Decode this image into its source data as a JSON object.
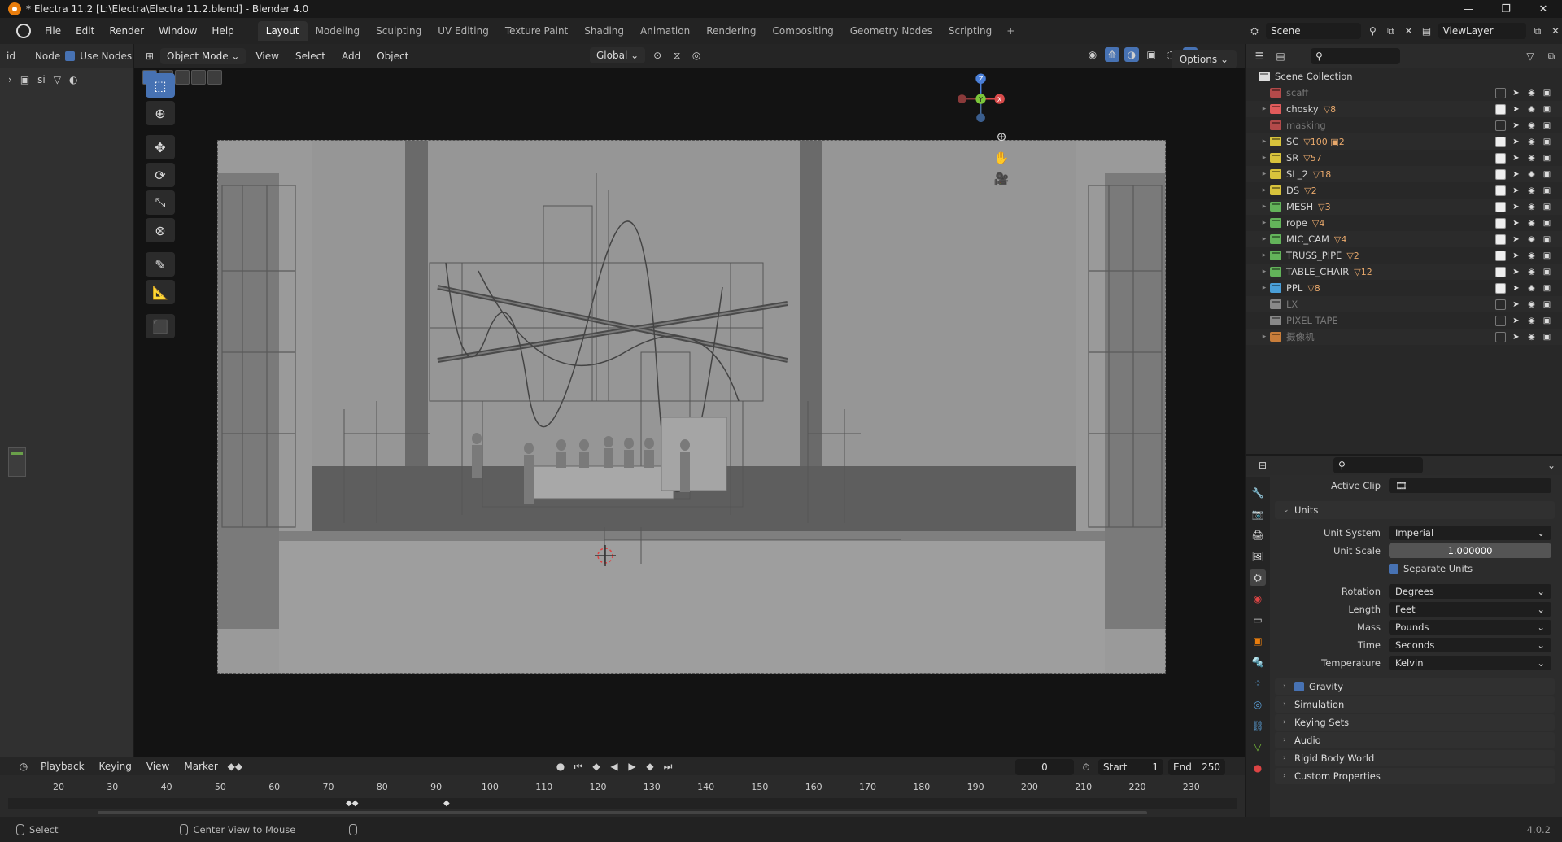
{
  "window": {
    "title": "* Electra 11.2 [L:\\Electra\\Electra 11.2.blend] - Blender 4.0"
  },
  "menu": [
    "File",
    "Edit",
    "Render",
    "Window",
    "Help"
  ],
  "workspaces": [
    "Layout",
    "Modeling",
    "Sculpting",
    "UV Editing",
    "Texture Paint",
    "Shading",
    "Animation",
    "Rendering",
    "Compositing",
    "Geometry Nodes",
    "Scripting"
  ],
  "active_workspace": "Layout",
  "scene": {
    "name": "Scene",
    "view_layer": "ViewLayer"
  },
  "left_panel": {
    "header_items": [
      "id",
      "Node"
    ],
    "use_nodes_label": "Use Nodes",
    "sub_label": "si"
  },
  "viewport": {
    "mode": "Object Mode",
    "menu": [
      "View",
      "Select",
      "Add",
      "Object"
    ],
    "orientation": "Global",
    "options_label": "Options",
    "gizmo_axes": {
      "z": "Z",
      "y": "Y",
      "x": "X"
    }
  },
  "outliner": {
    "root": "Scene Collection",
    "rows": [
      {
        "name": "scaff",
        "color": "#b34a4a",
        "dim": true,
        "badge": "",
        "checked": false
      },
      {
        "name": "chosky",
        "color": "#e05b5b",
        "dim": false,
        "badge": "▽8",
        "checked": true,
        "expand": true
      },
      {
        "name": "masking",
        "color": "#b34a4a",
        "dim": true,
        "badge": "",
        "checked": false
      },
      {
        "name": "SC",
        "color": "#d8c33c",
        "dim": false,
        "badge": "▽100 ▣2",
        "checked": true,
        "expand": true
      },
      {
        "name": "SR",
        "color": "#d8c33c",
        "dim": false,
        "badge": "▽57",
        "checked": true,
        "expand": true
      },
      {
        "name": "SL_2",
        "color": "#d8c33c",
        "dim": false,
        "badge": "▽18",
        "checked": true,
        "expand": true
      },
      {
        "name": "DS",
        "color": "#d8c33c",
        "dim": false,
        "badge": "▽2",
        "checked": true,
        "expand": true
      },
      {
        "name": "MESH",
        "color": "#63b35a",
        "dim": false,
        "badge": "▽3",
        "checked": true,
        "expand": true
      },
      {
        "name": "rope",
        "color": "#63b35a",
        "dim": false,
        "badge": "▽4",
        "checked": true,
        "expand": true
      },
      {
        "name": "MIC_CAM",
        "color": "#63b35a",
        "dim": false,
        "badge": "▽4",
        "checked": true,
        "expand": true
      },
      {
        "name": "TRUSS_PIPE",
        "color": "#63b35a",
        "dim": false,
        "badge": "▽2",
        "checked": true,
        "expand": true
      },
      {
        "name": "TABLE_CHAIR",
        "color": "#63b35a",
        "dim": false,
        "badge": "▽12",
        "checked": true,
        "expand": true
      },
      {
        "name": "PPL",
        "color": "#4a9fd8",
        "dim": false,
        "badge": "▽8",
        "checked": true,
        "expand": true
      },
      {
        "name": "LX",
        "color": "#888888",
        "dim": true,
        "badge": "",
        "checked": false
      },
      {
        "name": "PIXEL TAPE",
        "color": "#888888",
        "dim": true,
        "badge": "",
        "checked": false
      },
      {
        "name": "摄像机",
        "color": "#c87d3a",
        "dim": true,
        "badge": "",
        "checked": false,
        "expand": true
      }
    ]
  },
  "properties": {
    "active_clip_label": "Active Clip",
    "units_panel": "Units",
    "rows": [
      {
        "label": "Unit System",
        "value": "Imperial",
        "type": "enum"
      },
      {
        "label": "Unit Scale",
        "value": "1.000000",
        "type": "num"
      }
    ],
    "separate_units_label": "Separate Units",
    "rows2": [
      {
        "label": "Rotation",
        "value": "Degrees"
      },
      {
        "label": "Length",
        "value": "Feet"
      },
      {
        "label": "Mass",
        "value": "Pounds"
      },
      {
        "label": "Time",
        "value": "Seconds"
      },
      {
        "label": "Temperature",
        "value": "Kelvin"
      }
    ],
    "collapsed_panels": [
      "Gravity",
      "Simulation",
      "Keying Sets",
      "Audio",
      "Rigid Body World",
      "Custom Properties"
    ]
  },
  "timeline": {
    "menu": [
      "Playback",
      "Keying",
      "View",
      "Marker"
    ],
    "current_frame": "0",
    "start_label": "Start",
    "start": "1",
    "end_label": "End",
    "end": "250",
    "ticks": [
      "20",
      "30",
      "40",
      "50",
      "60",
      "70",
      "80",
      "90",
      "100",
      "110",
      "120",
      "130",
      "140",
      "150",
      "160",
      "170",
      "180",
      "190",
      "200",
      "210",
      "220",
      "230"
    ]
  },
  "status": {
    "select": "Select",
    "center": "Center View to Mouse",
    "version": "4.0.2"
  }
}
